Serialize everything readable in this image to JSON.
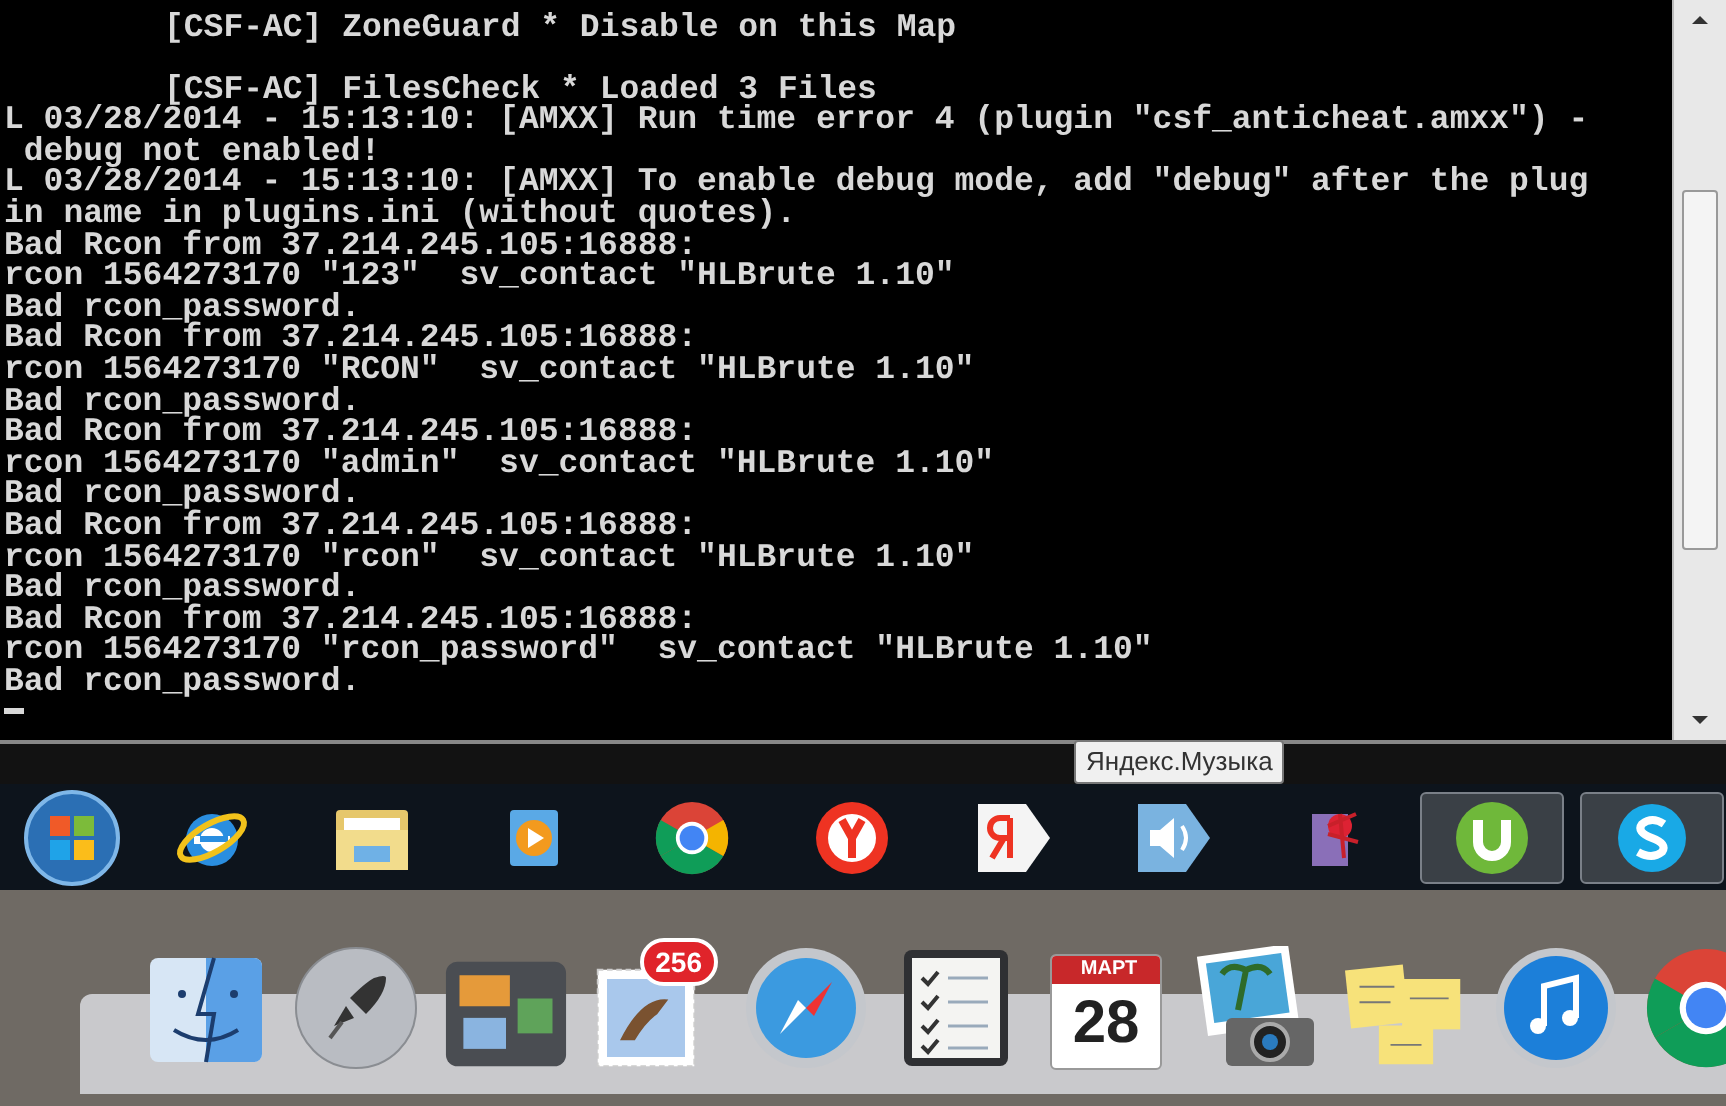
{
  "console": {
    "blocks": [
      [
        {
          "text": "[CSF-AC] ZoneGuard * Disable on this Map",
          "kind": "indented"
        }
      ],
      [
        {
          "text": "[CSF-AC] FilesCheck * Loaded 3 Files",
          "kind": "indented"
        },
        {
          "text": "L 03/28/2014 - 15:13:10: [AMXX] Run time error 4 (plugin \"csf_anticheat.amxx\") -",
          "kind": "plain"
        },
        {
          "text": " debug not enabled!",
          "kind": "plain"
        },
        {
          "text": "L 03/28/2014 - 15:13:10: [AMXX] To enable debug mode, add \"debug\" after the plug",
          "kind": "plain"
        },
        {
          "text": "in name in plugins.ini (without quotes).",
          "kind": "plain"
        },
        {
          "text": "Bad Rcon from 37.214.245.105:16888:",
          "kind": "plain"
        },
        {
          "text": "rcon 1564273170 \"123\"  sv_contact \"HLBrute 1.10\"",
          "kind": "plain"
        },
        {
          "text": "Bad rcon_password.",
          "kind": "plain"
        },
        {
          "text": "Bad Rcon from 37.214.245.105:16888:",
          "kind": "plain"
        },
        {
          "text": "rcon 1564273170 \"RCON\"  sv_contact \"HLBrute 1.10\"",
          "kind": "plain"
        },
        {
          "text": "Bad rcon_password.",
          "kind": "plain"
        },
        {
          "text": "Bad Rcon from 37.214.245.105:16888:",
          "kind": "plain"
        },
        {
          "text": "rcon 1564273170 \"admin\"  sv_contact \"HLBrute 1.10\"",
          "kind": "plain"
        },
        {
          "text": "Bad rcon_password.",
          "kind": "plain"
        },
        {
          "text": "Bad Rcon from 37.214.245.105:16888:",
          "kind": "plain"
        },
        {
          "text": "rcon 1564273170 \"rcon\"  sv_contact \"HLBrute 1.10\"",
          "kind": "plain"
        },
        {
          "text": "Bad rcon_password.",
          "kind": "plain"
        },
        {
          "text": "Bad Rcon from 37.214.245.105:16888:",
          "kind": "plain"
        },
        {
          "text": "rcon 1564273170 \"rcon_password\"  sv_contact \"HLBrute 1.10\"",
          "kind": "plain"
        },
        {
          "text": "Bad rcon_password.",
          "kind": "plain"
        }
      ]
    ]
  },
  "tooltip": {
    "text": "Яндекс.Музыка"
  },
  "taskbar": {
    "items": [
      {
        "kind": "start"
      },
      {
        "kind": "ie",
        "selected": false
      },
      {
        "kind": "folder",
        "selected": false
      },
      {
        "kind": "player",
        "selected": false
      },
      {
        "kind": "chrome",
        "selected": false
      },
      {
        "kind": "yabrowser",
        "selected": false
      },
      {
        "kind": "yandex",
        "selected": false
      },
      {
        "kind": "speaker",
        "selected": false
      },
      {
        "kind": "game",
        "selected": false
      },
      {
        "kind": "torrent",
        "selected": true
      },
      {
        "kind": "skype",
        "selected": true
      }
    ]
  },
  "dock": {
    "items": [
      {
        "kind": "finder"
      },
      {
        "kind": "rocket"
      },
      {
        "kind": "mission"
      },
      {
        "kind": "mail",
        "badge": "256"
      },
      {
        "kind": "safari"
      },
      {
        "kind": "reminders"
      },
      {
        "kind": "calendar",
        "month": "МАРТ",
        "day": "28"
      },
      {
        "kind": "photo"
      },
      {
        "kind": "notes"
      },
      {
        "kind": "music"
      },
      {
        "kind": "chrome"
      }
    ]
  }
}
